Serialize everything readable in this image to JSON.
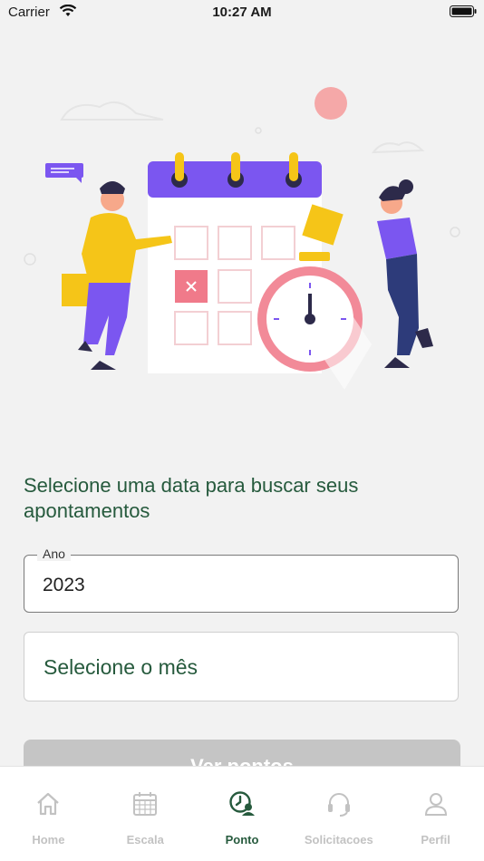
{
  "status_bar": {
    "carrier": "Carrier",
    "time": "10:27 AM"
  },
  "prompt": "Selecione uma data para buscar seus apontamentos",
  "year_field": {
    "legend": "Ano",
    "value": "2023"
  },
  "month_field": {
    "value": "Selecione o mês"
  },
  "view_button": {
    "label": "Ver pontos"
  },
  "tabs": [
    {
      "label": "Home",
      "icon": "home-icon"
    },
    {
      "label": "Escala",
      "icon": "calendar-icon"
    },
    {
      "label": "Ponto",
      "icon": "clock-user-icon"
    },
    {
      "label": "Solicitacoes",
      "icon": "headset-icon"
    },
    {
      "label": "Perfil",
      "icon": "user-icon"
    }
  ],
  "colors": {
    "accent": "#265a3d",
    "calendar": "#7b56f0",
    "disabled": "#c5c5c5"
  }
}
